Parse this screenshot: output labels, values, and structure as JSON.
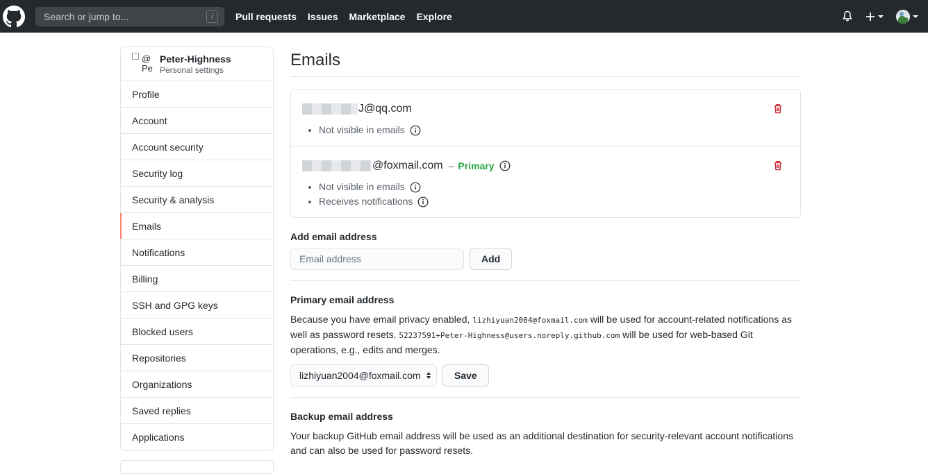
{
  "nav": {
    "search_placeholder": "Search or jump to...",
    "search_key": "/",
    "links": [
      "Pull requests",
      "Issues",
      "Marketplace",
      "Explore"
    ]
  },
  "sidebar": {
    "avatar_alt": "@Pe",
    "user_name": "Peter-Highness",
    "user_sub": "Personal settings",
    "active": "Emails",
    "items": [
      "Profile",
      "Account",
      "Account security",
      "Security log",
      "Security & analysis",
      "Emails",
      "Notifications",
      "Billing",
      "SSH and GPG keys",
      "Blocked users",
      "Repositories",
      "Organizations",
      "Saved replies",
      "Applications"
    ]
  },
  "main": {
    "title": "Emails",
    "emails": [
      {
        "address_visible": "J@qq.com",
        "primary_label": "",
        "notes": [
          "Not visible in emails"
        ]
      },
      {
        "address_visible": "@foxmail.com",
        "primary_label": "Primary",
        "notes": [
          "Not visible in emails",
          "Receives notifications"
        ]
      }
    ],
    "add": {
      "heading": "Add email address",
      "placeholder": "Email address",
      "button": "Add"
    },
    "primary": {
      "heading": "Primary email address",
      "text_1": "Because you have email privacy enabled, ",
      "email_1": "lizhiyuan2004@foxmail.com",
      "text_2": " will be used for account-related notifications as well as password resets. ",
      "email_2": "52237591+Peter-Highness@users.noreply.github.com",
      "text_3": " will be used for web-based Git operations, e.g., edits and merges.",
      "select_value": "lizhiyuan2004@foxmail.com",
      "button": "Save"
    },
    "backup": {
      "heading": "Backup email address",
      "text": "Your backup GitHub email address will be used as an additional destination for security-relevant account notifications and can also be used for password resets."
    }
  },
  "colors": {
    "header_bg": "#24292e",
    "active_accent": "#f9826c",
    "primary_green": "#28a745",
    "danger_red": "#cb2431"
  }
}
